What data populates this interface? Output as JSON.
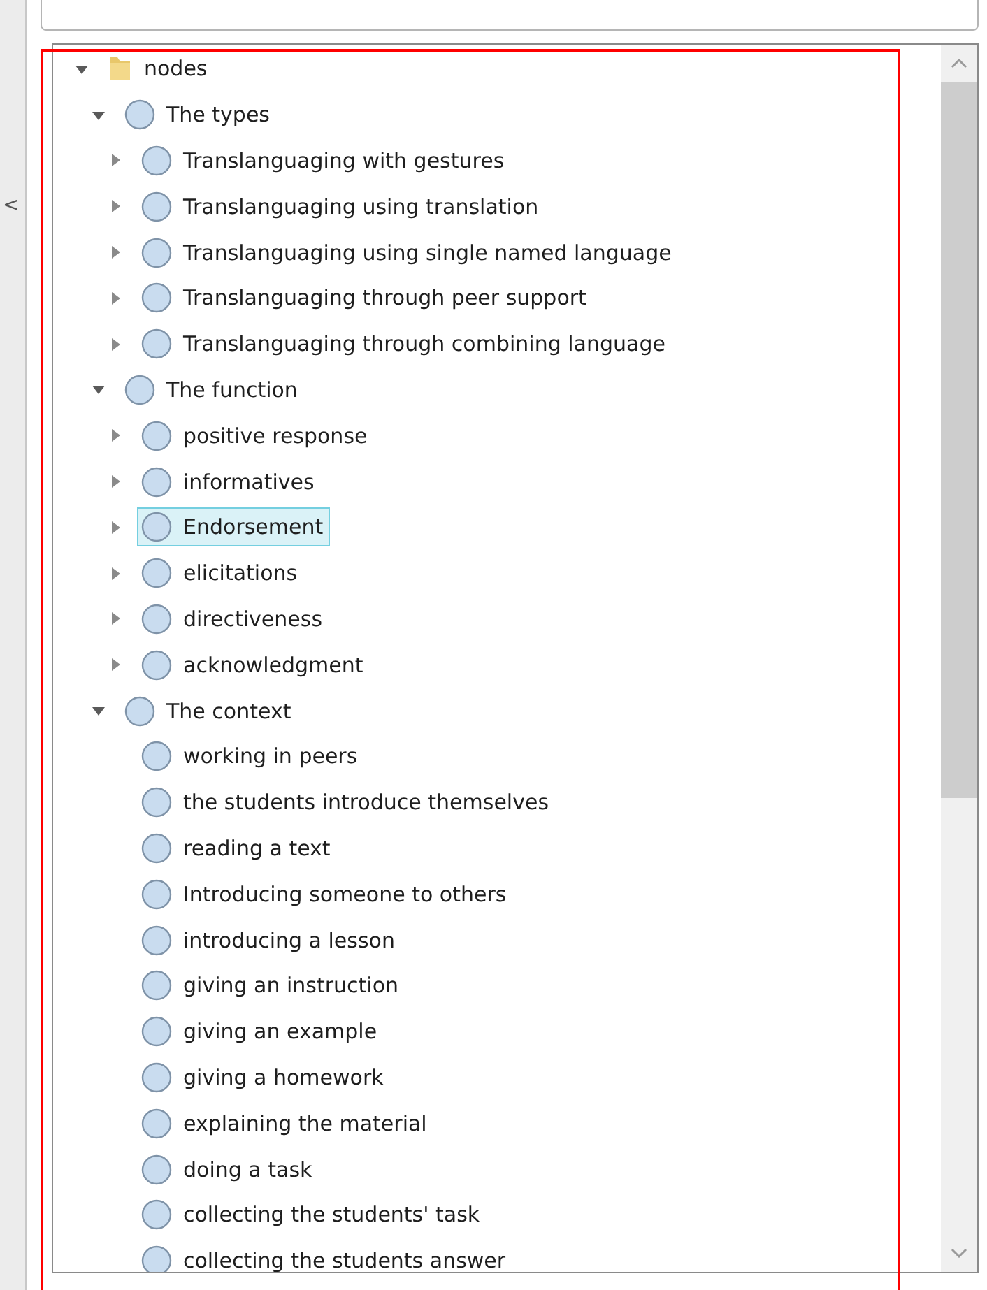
{
  "sidebar_toggle": "<",
  "tree": [
    {
      "label": "nodes",
      "kind": "folder",
      "expanded": true,
      "selected": false,
      "children": [
        {
          "label": "The types",
          "kind": "node",
          "expanded": true,
          "selected": false,
          "children": [
            {
              "label": "Translanguaging with gestures",
              "kind": "node",
              "expanded": false,
              "selected": false
            },
            {
              "label": "Translanguaging using translation",
              "kind": "node",
              "expanded": false,
              "selected": false
            },
            {
              "label": "Translanguaging using single named language",
              "kind": "node",
              "expanded": false,
              "selected": false
            },
            {
              "label": "Translanguaging through peer support",
              "kind": "node",
              "expanded": false,
              "selected": false
            },
            {
              "label": "Translanguaging through combining language",
              "kind": "node",
              "expanded": false,
              "selected": false
            }
          ]
        },
        {
          "label": "The function",
          "kind": "node",
          "expanded": true,
          "selected": false,
          "children": [
            {
              "label": "positive response",
              "kind": "node",
              "expanded": false,
              "selected": false
            },
            {
              "label": "informatives",
              "kind": "node",
              "expanded": false,
              "selected": false
            },
            {
              "label": "Endorsement",
              "kind": "node",
              "expanded": false,
              "selected": true
            },
            {
              "label": "elicitations",
              "kind": "node",
              "expanded": false,
              "selected": false
            },
            {
              "label": "directiveness",
              "kind": "node",
              "expanded": false,
              "selected": false
            },
            {
              "label": "acknowledgment",
              "kind": "node",
              "expanded": false,
              "selected": false
            }
          ]
        },
        {
          "label": "The context",
          "kind": "node",
          "expanded": true,
          "selected": false,
          "children": [
            {
              "label": "working in peers",
              "kind": "node",
              "selected": false
            },
            {
              "label": "the students introduce themselves",
              "kind": "node",
              "selected": false
            },
            {
              "label": "reading a text",
              "kind": "node",
              "selected": false
            },
            {
              "label": "Introducing someone to others",
              "kind": "node",
              "selected": false
            },
            {
              "label": "introducing a lesson",
              "kind": "node",
              "selected": false
            },
            {
              "label": "giving an instruction",
              "kind": "node",
              "selected": false
            },
            {
              "label": "giving an example",
              "kind": "node",
              "selected": false
            },
            {
              "label": "giving a homework",
              "kind": "node",
              "selected": false
            },
            {
              "label": "explaining the material",
              "kind": "node",
              "selected": false
            },
            {
              "label": "doing a task",
              "kind": "node",
              "selected": false
            },
            {
              "label": "collecting the students' task",
              "kind": "node",
              "selected": false
            },
            {
              "label": "collecting the students answer",
              "kind": "node",
              "selected": false
            }
          ]
        }
      ]
    }
  ]
}
